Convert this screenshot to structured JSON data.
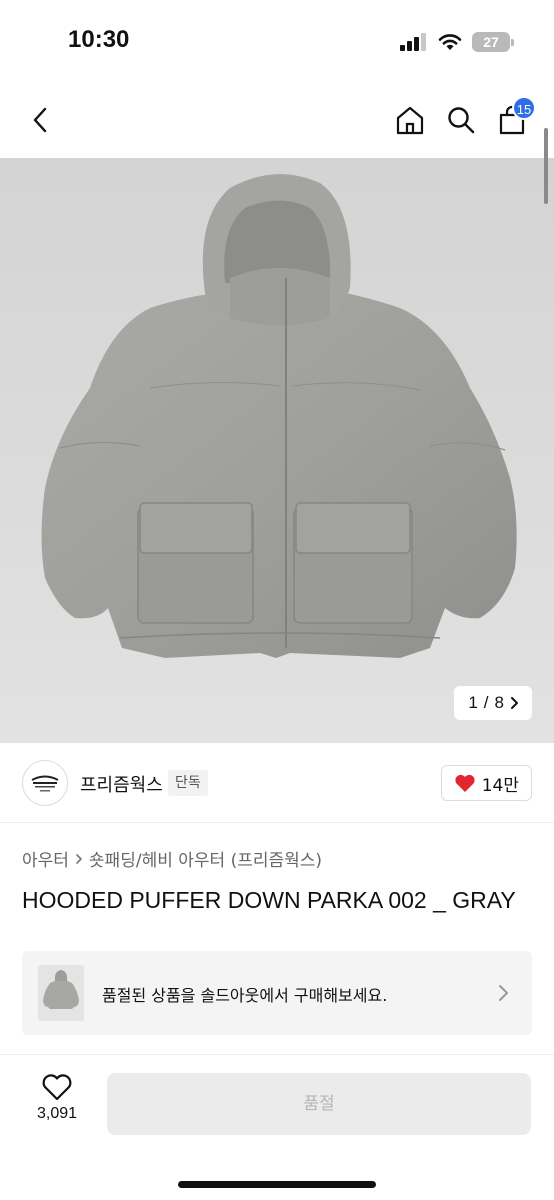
{
  "status_bar": {
    "time": "10:30",
    "battery": "27",
    "icons": [
      "cellular-signal-icon",
      "wifi-icon",
      "battery-icon"
    ]
  },
  "nav": {
    "cart_badge": "15",
    "icons": [
      "back-chevron-icon",
      "home-icon",
      "search-icon",
      "cart-icon"
    ],
    "accent_color": "#2e6fe6"
  },
  "gallery": {
    "current": "1",
    "separator": "/",
    "total": "8"
  },
  "brand": {
    "name": "프리즘웍스",
    "tag": "단독",
    "likes": "14만",
    "heart_color": "#e0262e"
  },
  "breadcrumb": {
    "items": [
      "아우터",
      "숏패딩/헤비 아우터 (프리즘웍스)"
    ]
  },
  "product": {
    "title": "HOODED PUFFER DOWN PARKA 002 _ GRAY"
  },
  "soldout_banner": {
    "text": "품절된 상품을 솔드아웃에서 구매해보세요."
  },
  "bottom_bar": {
    "like_count": "3,091",
    "button_label": "품절"
  }
}
